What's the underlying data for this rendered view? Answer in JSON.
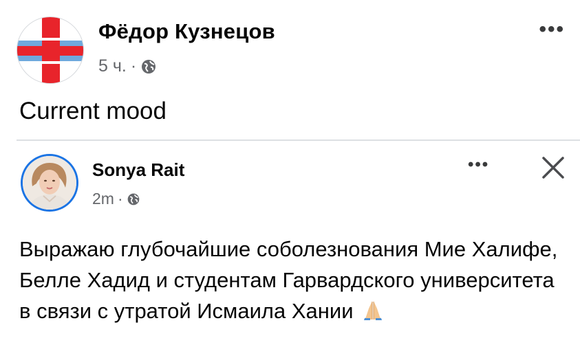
{
  "post": {
    "author": "Фёдор Кузнецов",
    "time": "5 ч.",
    "separator": "·",
    "text": "Current mood",
    "more_label": "•••"
  },
  "shared_post": {
    "author": "Sonya Rait",
    "time": "2m",
    "separator": "·",
    "more_label": "•••",
    "text": "Выражаю глубочайшие соболезнования Мие Халифе, Белле Хадид и студентам Гарвардского университета в связи с утратой Исмаила Хании"
  },
  "colors": {
    "name_text": "#050505",
    "meta_text": "#65676b",
    "avatar_ring": "#1b74e4",
    "logo_red": "#e8242b",
    "logo_blue": "#6fa9dd"
  },
  "icons": {
    "globe": "globe-icon",
    "more": "more-options-icon",
    "close": "close-icon",
    "pray": "praying-hands-icon"
  }
}
